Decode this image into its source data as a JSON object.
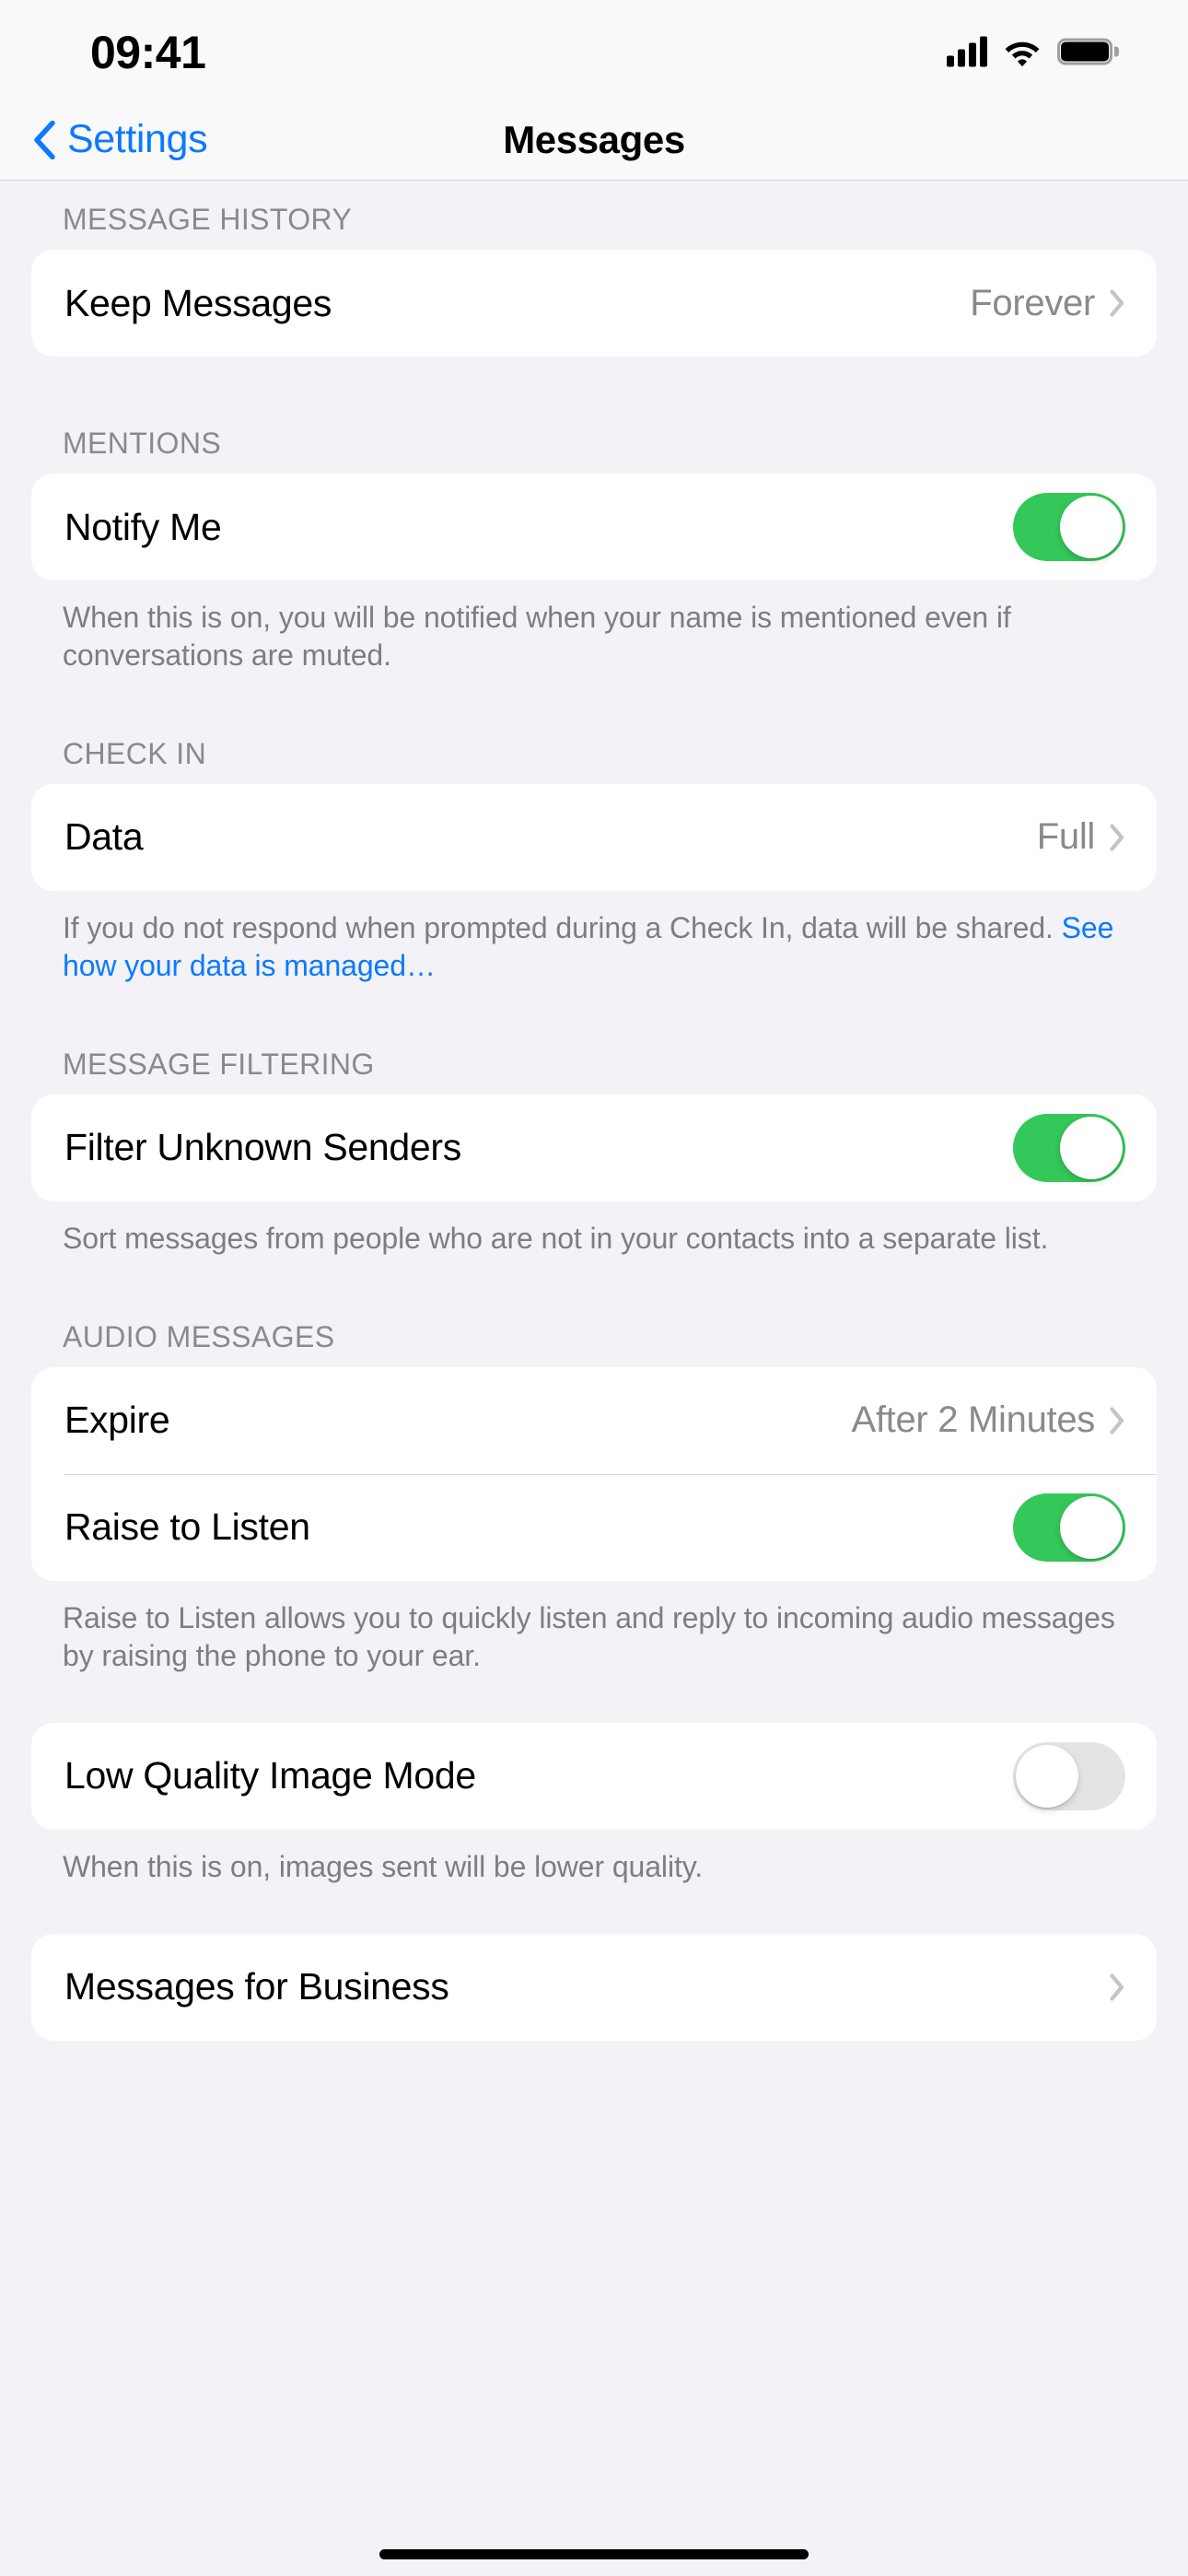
{
  "status_bar": {
    "time": "09:41",
    "cellular_icon": "cellular-bars-icon",
    "wifi_icon": "wifi-icon",
    "battery_icon": "battery-full-icon"
  },
  "nav": {
    "back_label": "Settings",
    "back_icon": "chevron-left-icon",
    "title": "Messages"
  },
  "sections": [
    {
      "header": "MESSAGE HISTORY",
      "rows": [
        {
          "label": "Keep Messages",
          "value": "Forever",
          "type": "disclosure"
        }
      ],
      "footer": null
    },
    {
      "header": "MENTIONS",
      "rows": [
        {
          "label": "Notify Me",
          "type": "toggle",
          "on": true
        }
      ],
      "footer": "When this is on, you will be notified when your name is mentioned even if conversations are muted."
    },
    {
      "header": "CHECK IN",
      "rows": [
        {
          "label": "Data",
          "value": "Full",
          "type": "disclosure"
        }
      ],
      "footer": "If you do not respond when prompted during a Check In, data will be shared. ",
      "footer_link": "See how your data is managed…"
    },
    {
      "header": "MESSAGE FILTERING",
      "rows": [
        {
          "label": "Filter Unknown Senders",
          "type": "toggle",
          "on": true
        }
      ],
      "footer": "Sort messages from people who are not in your contacts into a separate list."
    },
    {
      "header": "AUDIO MESSAGES",
      "rows": [
        {
          "label": "Expire",
          "value": "After 2 Minutes",
          "type": "disclosure"
        },
        {
          "label": "Raise to Listen",
          "type": "toggle",
          "on": true
        }
      ],
      "footer": "Raise to Listen allows you to quickly listen and reply to incoming audio messages by raising the phone to your ear."
    },
    {
      "header": "",
      "rows": [
        {
          "label": "Low Quality Image Mode",
          "type": "toggle",
          "on": false
        }
      ],
      "footer": "When this is on, images sent will be lower quality."
    },
    {
      "header": "",
      "rows": [
        {
          "label": "Messages for Business",
          "value": "",
          "type": "disclosure"
        }
      ],
      "footer": null
    }
  ],
  "colors": {
    "accent_blue": "#0A7AFF",
    "toggle_on_green": "#34C759",
    "toggle_off_gray": "#E4E4E6",
    "page_background": "#F2F2F7",
    "group_background": "#FFFFFF",
    "secondary_text": "#8A8A8E"
  },
  "home_indicator": "home-indicator"
}
